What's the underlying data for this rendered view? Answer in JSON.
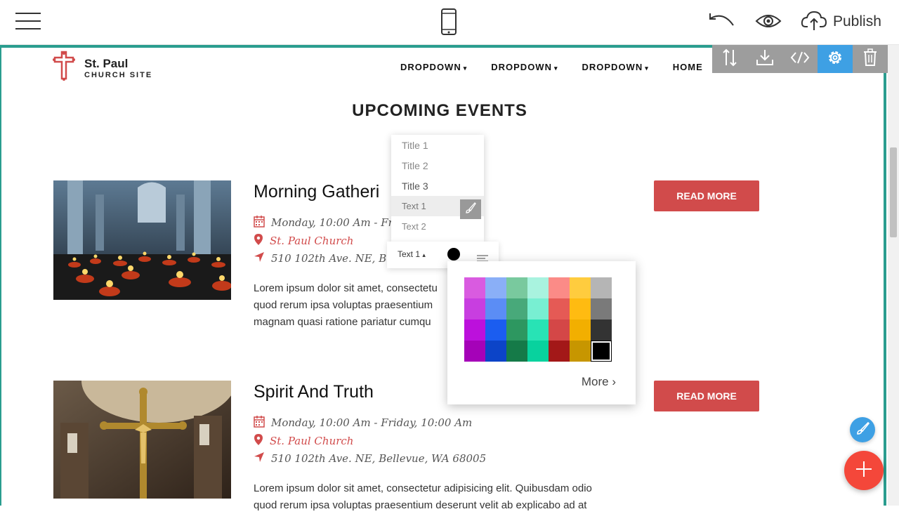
{
  "toolbar": {
    "publish_label": "Publish"
  },
  "site": {
    "name": "St. Paul",
    "tagline": "CHURCH SITE",
    "nav": [
      {
        "label": "DROPDOWN",
        "caret": "▾"
      },
      {
        "label": "DROPDOWN",
        "caret": "▾"
      },
      {
        "label": "DROPDOWN",
        "caret": "▾"
      },
      {
        "label": "HOME",
        "caret": ""
      }
    ]
  },
  "section": {
    "title": "UPCOMING EVENTS"
  },
  "events": [
    {
      "title": "Morning Gatheri",
      "date": "Monday, 10:00 Am - Frid",
      "place": "St. Paul Church",
      "address": "510 102th Ave. NE, Belle",
      "text_lines": [
        "Lorem ipsum dolor sit amet, consectetu",
        "quod rerum ipsa voluptas praesentium",
        "magnam quasi ratione pariatur cumqu"
      ],
      "button": "READ MORE"
    },
    {
      "title": "Spirit And Truth",
      "date": "Monday, 10:00 Am - Friday, 10:00 Am",
      "place": "St. Paul Church",
      "address": "510 102th Ave. NE, Bellevue, WA 68005",
      "text_lines": [
        "Lorem ipsum dolor sit amet, consectetur adipisicing elit. Quibusdam odio",
        "quod rerum ipsa voluptas praesentium deserunt velit ab explicabo ad at"
      ],
      "button": "READ MORE"
    }
  ],
  "style_menu": {
    "options": [
      "Title 1",
      "Title 2",
      "Title 3",
      "Text 1",
      "Text 2"
    ],
    "selected": "Text 1"
  },
  "format_bar": {
    "style_label": "Text 1",
    "caret": "▴"
  },
  "palette": {
    "colors": [
      "#d95be0",
      "#8aaff7",
      "#79c99e",
      "#a9f3df",
      "#fb8b87",
      "#ffcc3e",
      "#b5b5b5",
      "#c83ee0",
      "#5b8df5",
      "#48a97a",
      "#78efd2",
      "#e55a55",
      "#ffbb11",
      "#7a7a7a",
      "#bc10dc",
      "#1b5df0",
      "#2d9760",
      "#28e3b5",
      "#d44747",
      "#f2af00",
      "#333333",
      "#a502b8",
      "#0c44c8",
      "#157a48",
      "#08d29e",
      "#a31818",
      "#c79600",
      "#000000"
    ],
    "selected": "#000000",
    "more_label": "More ›"
  }
}
